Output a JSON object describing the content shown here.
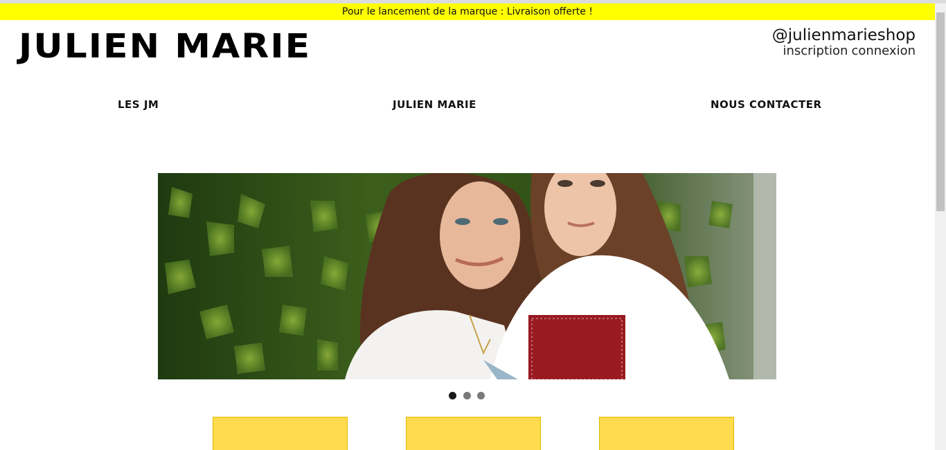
{
  "promo": {
    "text": "Pour le lancement de la marque : Livraison offerte !",
    "color": "#ffff00"
  },
  "header": {
    "logo": "JULIEN MARIE",
    "social_handle": "@julienmarieshop",
    "signup_label": "inscription",
    "login_label": "connexion"
  },
  "nav": {
    "items": [
      {
        "label": "LES JM"
      },
      {
        "label": "JULIEN MARIE"
      },
      {
        "label": "NOUS CONTACTER"
      }
    ]
  },
  "carousel": {
    "slide_count": 3,
    "active_index": 0,
    "dot_colors": {
      "active": "#1a1a1a",
      "inactive": "#7a7a7a"
    }
  },
  "cards": {
    "count": 3,
    "color": "#ffdb4d"
  }
}
